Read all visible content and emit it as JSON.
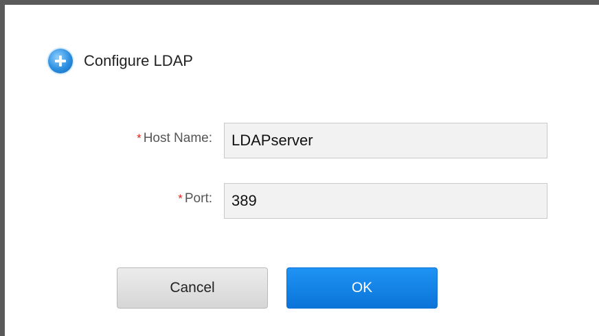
{
  "dialog": {
    "title": "Configure LDAP",
    "icon": "plus-circle-icon"
  },
  "form": {
    "required_marker": "*",
    "host_name": {
      "label": "Host Name:",
      "value": "LDAPserver"
    },
    "port": {
      "label": "Port:",
      "value": "389"
    }
  },
  "buttons": {
    "cancel_label": "Cancel",
    "ok_label": "OK"
  },
  "colors": {
    "accent": "#0b74d8",
    "required": "#e2231a",
    "frame_border": "#5a5a5a"
  }
}
